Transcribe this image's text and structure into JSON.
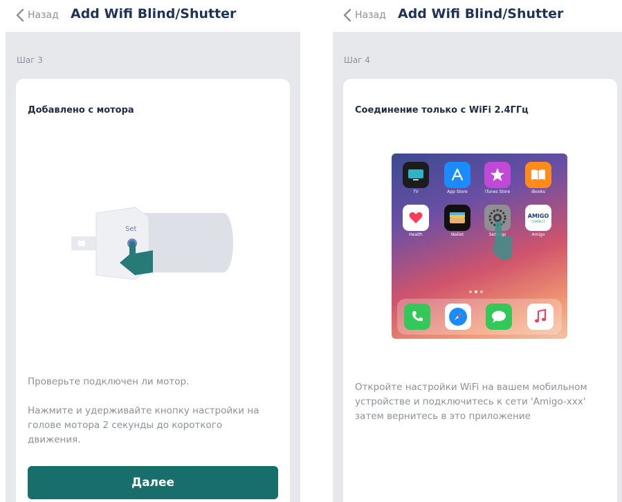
{
  "colors": {
    "title": "#1f3258",
    "button": "#176e6b",
    "muted_text": "#8b9099",
    "background": "#e6e8ec",
    "hand": "#267a78"
  },
  "screens": [
    {
      "back_label": "Назад",
      "back_icon": "chevron-left-icon",
      "title": "Add Wifi Blind/Shutter",
      "step": "Шаг 3",
      "card_title": "Добавлено с мотора",
      "illustration": {
        "motor_button_label": "Set",
        "hand_icon": "pointing-hand-icon"
      },
      "paragraphs": [
        "Проверьте подключен ли мотор.",
        "Нажмите и удерживайте кнопку настройки на голове мотора 2 секунды до короткого движения."
      ],
      "button": "Далее"
    },
    {
      "back_label": "Назад",
      "back_icon": "chevron-left-icon",
      "title": "Add Wifi Blind/Shutter",
      "step": "Шаг 4",
      "card_title": "Соединение только с WiFi 2.4ГГц",
      "apps": [
        {
          "label": "TV",
          "icon": "tv-app-icon"
        },
        {
          "label": "App Store",
          "icon": "app-store-icon"
        },
        {
          "label": "iTunes Store",
          "icon": "itunes-store-icon"
        },
        {
          "label": "iBooks",
          "icon": "ibooks-icon"
        },
        {
          "label": "Health",
          "icon": "health-icon"
        },
        {
          "label": "Wallet",
          "icon": "wallet-icon"
        },
        {
          "label": "Settings",
          "icon": "settings-gear-icon"
        },
        {
          "label": "Amigo",
          "icon": "amigo-connect-icon",
          "logo_text": "AMIGO",
          "logo_sub": "CONNECT"
        }
      ],
      "dock_apps": [
        "phone-icon",
        "safari-icon",
        "messages-icon",
        "music-icon"
      ],
      "paragraph": "Откройте настройки WiFi на вашем мобильном устройстве и подключитесь к сети 'Amigo-xxx' затем вернитесь в это приложение"
    }
  ]
}
